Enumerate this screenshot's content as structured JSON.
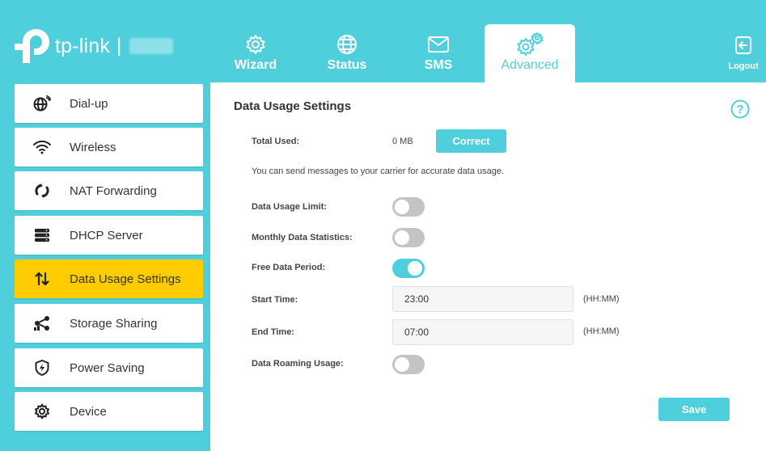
{
  "header": {
    "brand": "tp-link",
    "separator": "|",
    "model": "",
    "tabs": [
      {
        "label": "Wizard",
        "icon": "gear-icon",
        "active": false
      },
      {
        "label": "Status",
        "icon": "globe-icon",
        "active": false
      },
      {
        "label": "SMS",
        "icon": "envelope-icon",
        "active": false
      },
      {
        "label": "Advanced",
        "icon": "gears-icon",
        "active": true
      }
    ],
    "logout_label": "Logout"
  },
  "sidebar": {
    "items": [
      {
        "label": "Dial-up",
        "icon": "globe-signal-icon",
        "active": false
      },
      {
        "label": "Wireless",
        "icon": "wifi-icon",
        "active": false
      },
      {
        "label": "NAT Forwarding",
        "icon": "nat-icon",
        "active": false
      },
      {
        "label": "DHCP Server",
        "icon": "server-icon",
        "active": false
      },
      {
        "label": "Data Usage Settings",
        "icon": "up-down-arrows-icon",
        "active": true
      },
      {
        "label": "Storage Sharing",
        "icon": "share-icon",
        "active": false
      },
      {
        "label": "Power Saving",
        "icon": "shield-bolt-icon",
        "active": false
      },
      {
        "label": "Device",
        "icon": "gear-icon",
        "active": false
      }
    ]
  },
  "main": {
    "title": "Data Usage Settings",
    "total_used": {
      "label": "Total Used:",
      "value": "0 MB",
      "button": "Correct"
    },
    "info": "You can send messages to your carrier for accurate data usage.",
    "data_usage_limit": {
      "label": "Data Usage Limit:",
      "on": false
    },
    "monthly_statistics": {
      "label": "Monthly Data Statistics:",
      "on": false
    },
    "free_data_period": {
      "label": "Free Data Period:",
      "on": true
    },
    "start_time": {
      "label": "Start Time:",
      "value": "23:00",
      "hint": "(HH:MM)"
    },
    "end_time": {
      "label": "End Time:",
      "value": "07:00",
      "hint": "(HH:MM)"
    },
    "data_roaming": {
      "label": "Data Roaming Usage:",
      "on": false
    },
    "save_label": "Save"
  },
  "colors": {
    "accent": "#4fcfdb",
    "active_sidebar": "#ffcc00",
    "toggle_off": "#c4c4c4"
  }
}
